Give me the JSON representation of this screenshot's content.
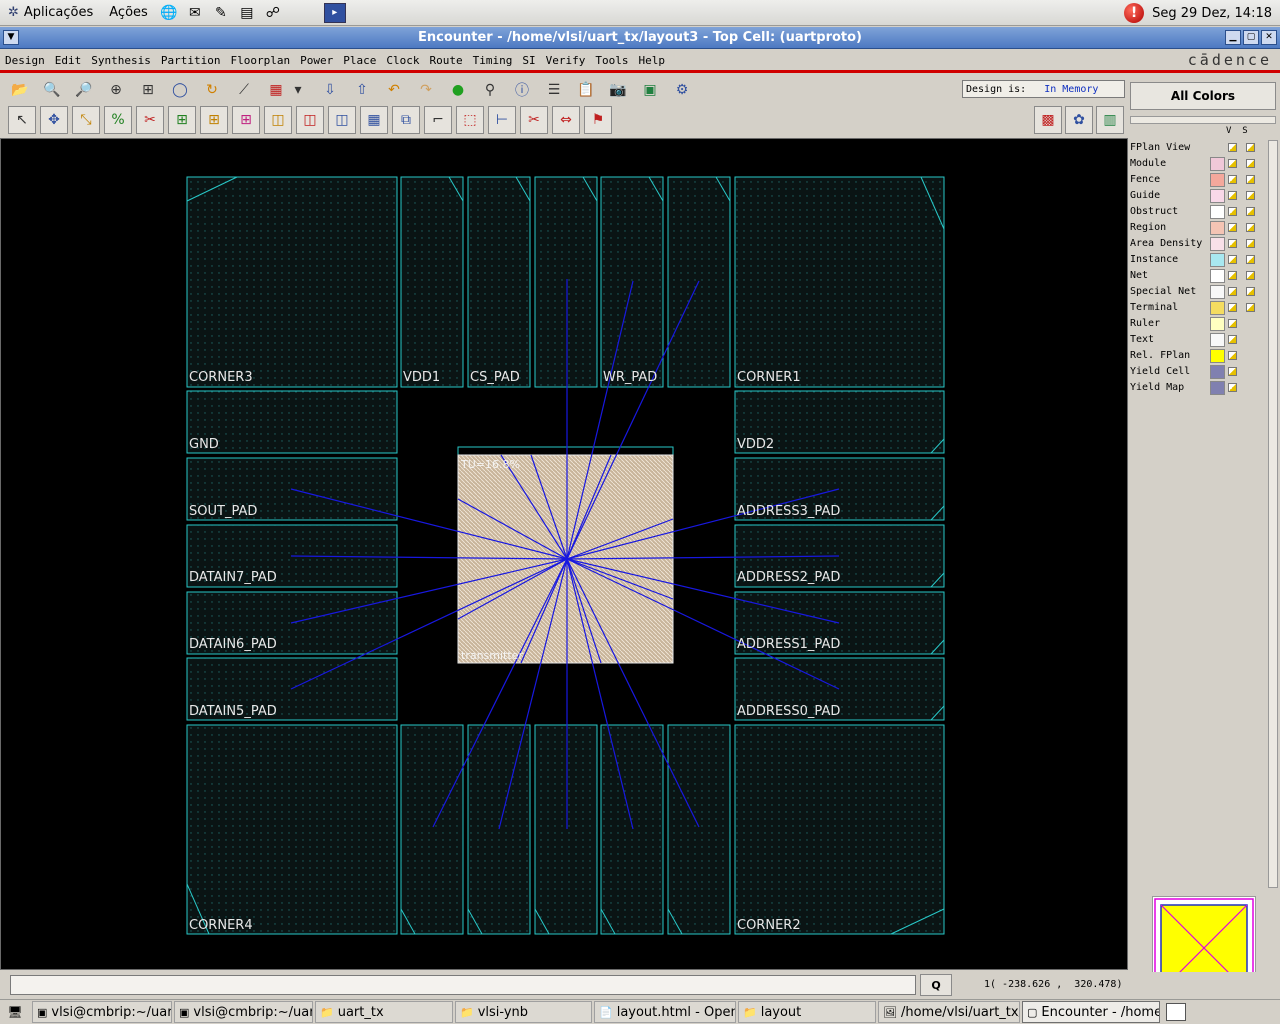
{
  "top_panel": {
    "menus": [
      "Aplicações",
      "Ações"
    ],
    "launcher_icons": [
      "globe-icon",
      "mail-icon",
      "editor-icon",
      "writer-icon",
      "network-icon",
      "terminal-icon"
    ],
    "clock": "Seg 29 Dez, 14:18"
  },
  "window": {
    "title": "Encounter - /home/vlsi/uart_tx/layout3 - Top Cell: (uartproto)",
    "title_color": "#4d79c2"
  },
  "menubar": {
    "items": [
      "Design",
      "Edit",
      "Synthesis",
      "Partition",
      "Floorplan",
      "Power",
      "Place",
      "Clock",
      "Route",
      "Timing",
      "SI",
      "Verify",
      "Tools",
      "Help"
    ],
    "logo": "cādence"
  },
  "toolbar1": {
    "icons": [
      "open-icon",
      "zoom-in-icon",
      "zoom-out-icon",
      "zoom-area-icon",
      "fit-icon",
      "redraw-icon",
      "refresh-icon",
      "select-mode-icon",
      "fill-pattern-icon",
      "dropdown-icon",
      "hier-down-icon",
      "hier-up-icon",
      "undo-icon",
      "redo-icon",
      "status-icon",
      "hierarchy-icon",
      "info-icon",
      "notes-icon",
      "clipboard-icon",
      "camera-icon",
      "screen-icon",
      "tools-icon"
    ]
  },
  "design_status": {
    "label": "Design is:",
    "value": "In Memory"
  },
  "toolbar2": {
    "icons": [
      "select-icon",
      "move-icon",
      "resize-icon",
      "percent-icon",
      "cut-wire-icon",
      "add-module-icon",
      "add-fence-icon",
      "add-guide-icon",
      "add-region-icon",
      "add-obstruct-icon",
      "add-block-icon",
      "grid-icon",
      "snap-icon",
      "place-icon",
      "edit-shape-icon",
      "ruler-icon",
      "cut-icon",
      "stretch-icon",
      "flag-icon"
    ],
    "view_icons": [
      "floorplan-view-icon",
      "amoeba-view-icon",
      "physical-view-icon"
    ]
  },
  "right_panel": {
    "all_colors": "All Colors",
    "col_v": "V",
    "col_s": "S",
    "layers": [
      {
        "name": "FPlan View",
        "color": ""
      },
      {
        "name": "Module",
        "color": "#f0c8d8"
      },
      {
        "name": "Fence",
        "color": "#f4a89c"
      },
      {
        "name": "Guide",
        "color": "#f8d8e8"
      },
      {
        "name": "Obstruct",
        "color": "#ffffff"
      },
      {
        "name": "Region",
        "color": "#f4c4b4"
      },
      {
        "name": "Area Density",
        "color": "#f8e0e8"
      },
      {
        "name": "Instance",
        "color": "#a8e8f0"
      },
      {
        "name": "Net",
        "color": "#ffffff"
      },
      {
        "name": "Special Net",
        "color": "#f8f8f8"
      },
      {
        "name": "Terminal",
        "color": "#f4dc60"
      },
      {
        "name": "Ruler",
        "color": "#ffffc0"
      },
      {
        "name": "Text",
        "color": "#f8f8f8"
      },
      {
        "name": "Rel. FPlan",
        "color": "#ffff00"
      },
      {
        "name": "Yield Cell",
        "color": "#8080b0"
      },
      {
        "name": "Yield Map",
        "color": "#8080b0"
      }
    ]
  },
  "layout": {
    "module_name": "transmitter",
    "module_util": "TU=16.8%",
    "pad_color": "#28c8c8",
    "net_color": "#1818e0",
    "module_fill": "#c8b49a",
    "pads": {
      "corner3": "CORNER3",
      "vdd1": "VDD1",
      "cs_pad": "CS_PAD",
      "wr_pad": "WR_PAD",
      "corner1": "CORNER1",
      "gnd": "GND",
      "vdd2": "VDD2",
      "sout_pad": "SOUT_PAD",
      "address3_pad": "ADDRESS3_PAD",
      "datain7_pad": "DATAIN7_PAD",
      "address2_pad": "ADDRESS2_PAD",
      "datain6_pad": "DATAIN6_PAD",
      "address1_pad": "ADDRESS1_PAD",
      "datain5_pad": "DATAIN5_PAD",
      "address0_pad": "ADDRESS0_PAD",
      "corner4": "CORNER4",
      "corner2": "CORNER2"
    }
  },
  "command_bar": {
    "input_value": "",
    "q_label": "Q",
    "coords": "1( -238.626 ,  320.478)"
  },
  "taskbar": {
    "tasks": [
      {
        "label": "vlsi@cmbrip:~/uart_",
        "icon": "terminal-icon",
        "active": false
      },
      {
        "label": "vlsi@cmbrip:~/uart_",
        "icon": "terminal-icon",
        "active": false
      },
      {
        "label": "uart_tx",
        "icon": "folder-icon",
        "active": false
      },
      {
        "label": "vlsi-ynb",
        "icon": "folder-icon",
        "active": false
      },
      {
        "label": "layout.html - OpenC",
        "icon": "document-icon",
        "active": false
      },
      {
        "label": "layout",
        "icon": "folder-icon",
        "active": false
      },
      {
        "label": "/home/vlsi/uart_tx/la",
        "icon": "image-icon",
        "active": false
      },
      {
        "label": "Encounter - /home/v",
        "icon": "window-icon",
        "active": true
      }
    ]
  }
}
